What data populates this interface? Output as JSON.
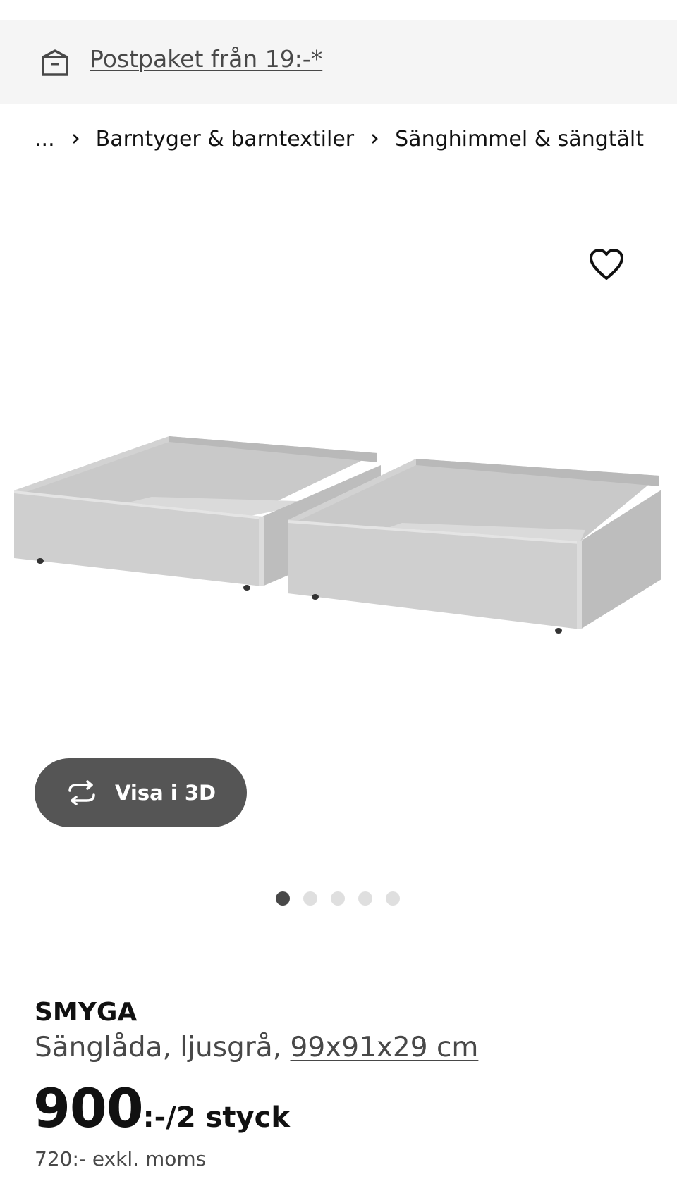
{
  "banner": {
    "icon": "parcel-box-icon",
    "link_text": "Postpaket från 19:-*"
  },
  "breadcrumb": {
    "ellipsis": "...",
    "items": [
      "Barntyger & barntextiler",
      "Sänghimmel & sängtält"
    ],
    "separator_icon": "chevron-right-icon"
  },
  "gallery": {
    "favorite_icon": "heart-outline-icon",
    "view3d": {
      "icon": "rotate-3d-icon",
      "label": "Visa i 3D"
    },
    "image_count": 5,
    "active_image": 1
  },
  "product": {
    "name": "SMYGA",
    "description": "Sänglåda, ljusgrå,",
    "dimensions": "99x91x29 cm",
    "price": "900",
    "price_suffix": ":-/2 styck",
    "price_ex_vat": "720:- exkl. moms"
  },
  "colors": {
    "text_primary": "#111111",
    "text_secondary": "#484848",
    "banner_bg": "#f5f5f5",
    "button_bg": "#555555",
    "dot_active": "#484848",
    "dot_inactive": "#dfdfdf"
  }
}
